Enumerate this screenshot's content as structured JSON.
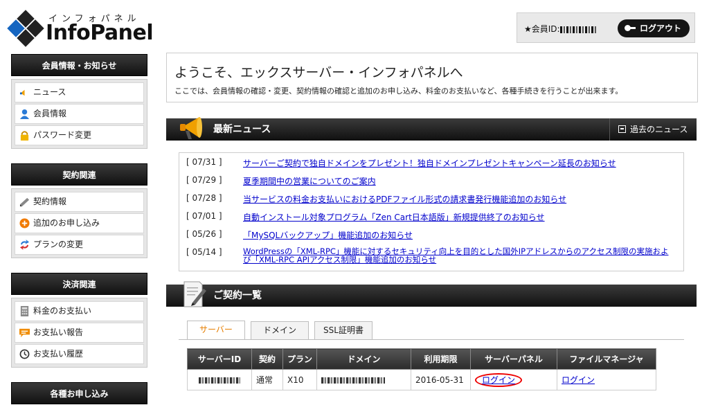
{
  "header": {
    "logo_kana": "インフォパネル",
    "logo_text_a": "Info",
    "logo_text_b": "Panel",
    "member_label": "★会員ID:",
    "logout_label": "ログアウト"
  },
  "sidebar": {
    "sections": [
      {
        "title": "会員情報・お知らせ",
        "items": [
          {
            "label": "ニュース",
            "icon": "megaphone-icon"
          },
          {
            "label": "会員情報",
            "icon": "person-icon"
          },
          {
            "label": "パスワード変更",
            "icon": "lock-icon"
          }
        ]
      },
      {
        "title": "契約関連",
        "items": [
          {
            "label": "契約情報",
            "icon": "pen-icon"
          },
          {
            "label": "追加のお申し込み",
            "icon": "plus-circle-icon"
          },
          {
            "label": "プランの変更",
            "icon": "change-arrows-icon"
          }
        ]
      },
      {
        "title": "決済関連",
        "items": [
          {
            "label": "料金のお支払い",
            "icon": "calculator-icon"
          },
          {
            "label": "お支払い報告",
            "icon": "speech-bubble-icon"
          },
          {
            "label": "お支払い履歴",
            "icon": "clock-icon"
          }
        ]
      },
      {
        "title": "各種お申し込み",
        "items": []
      }
    ]
  },
  "welcome": {
    "title": "ようこそ、エックスサーバー・インフォパネルへ",
    "desc": "ここでは、会員情報の確認・変更、契約情報の確認と追加のお申し込み、料金のお支払いなど、各種手続きを行うことが出来ます。"
  },
  "news": {
    "title": "最新ニュース",
    "past_label": "過去のニュース",
    "items": [
      {
        "date": "[ 07/31 ]",
        "text": "サーバーご契約で独自ドメインをプレゼント！独自ドメインプレゼントキャンペーン延長のお知らせ"
      },
      {
        "date": "[ 07/29 ]",
        "text": "夏季期間中の営業についてのご案内"
      },
      {
        "date": "[ 07/28 ]",
        "text": "当サービスの料金お支払いにおけるPDFファイル形式の請求書発行機能追加のお知らせ"
      },
      {
        "date": "[ 07/01 ]",
        "text": "自動インストール対象プログラム「Zen Cart日本語版」新規提供終了のお知らせ"
      },
      {
        "date": "[ 05/26 ]",
        "text": "「MySQLバックアップ」機能追加のお知らせ"
      },
      {
        "date": "[ 05/14 ]",
        "text": "WordPressの「XML-RPC」機能に対するセキュリティ向上を目的とした国外IPアドレスからのアクセス制限の実施および「XML-RPC APIアクセス制限」機能追加のお知らせ"
      }
    ]
  },
  "contracts": {
    "title": "ご契約一覧",
    "tabs": [
      "サーバー",
      "ドメイン",
      "SSL証明書"
    ],
    "columns": [
      "サーバーID",
      "契約",
      "プラン",
      "ドメイン",
      "利用期限",
      "サーバーパネル",
      "ファイルマネージャ"
    ],
    "row": {
      "contract": "通常",
      "plan": "X10",
      "expiry": "2016-05-31",
      "panel_link": "ログイン",
      "file_link": "ログイン"
    }
  }
}
